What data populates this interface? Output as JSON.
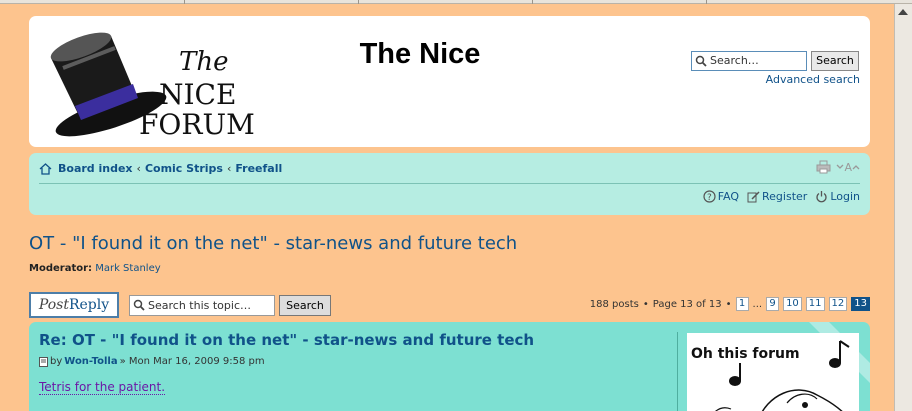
{
  "header": {
    "site_title": "The Nice",
    "logo_text": [
      "The",
      "NICE",
      "FORUM"
    ],
    "search_placeholder": "Search…",
    "search_button": "Search",
    "advanced_search": "Advanced search"
  },
  "nav": {
    "breadcrumbs": [
      "Board index",
      "Comic Strips",
      "Freefall"
    ],
    "separator": "‹",
    "font_size_label": "A",
    "faq": "FAQ",
    "register": "Register",
    "login": "Login"
  },
  "topic": {
    "title": "OT - \"I found it on the net\" - star-news and future tech",
    "moderator_label": "Moderator:",
    "moderator_name": "Mark Stanley"
  },
  "actions": {
    "post_reply_prefix": "Post",
    "post_reply_suffix": "Reply",
    "topic_search_placeholder": "Search this topic…",
    "topic_search_button": "Search",
    "post_count": "188 posts",
    "page_info": "Page 13 of 13",
    "pages": [
      "1",
      "9",
      "10",
      "11",
      "12",
      "13"
    ],
    "ellipsis": "...",
    "current_page": "13"
  },
  "post": {
    "subject": "Re: OT - \"I found it on the net\" - star-news and future tech",
    "by": "by",
    "author": "Won-Tolla",
    "date": "» Mon Mar 16, 2009 9:58 pm",
    "body": "Tetris for the patient.",
    "avatar_text": "Oh this forum"
  },
  "colors": {
    "background": "#fdc48e",
    "header_bg": "#ffffff",
    "nav_bg": "#b6ede2",
    "post_bg": "#7de0d2",
    "link": "#105289"
  }
}
